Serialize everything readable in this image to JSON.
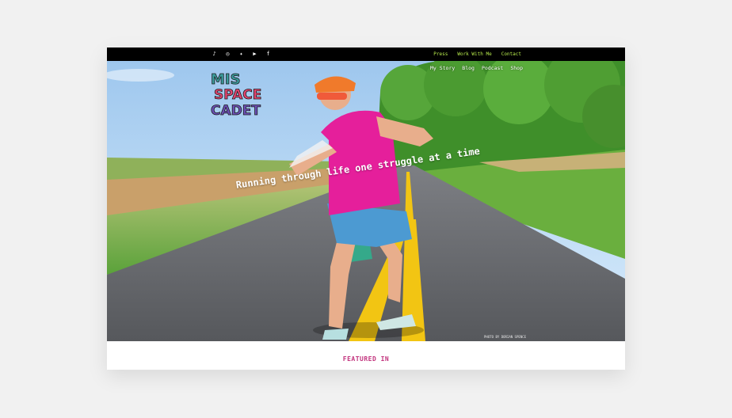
{
  "social": {
    "icons": [
      {
        "name": "tiktok-icon",
        "glyph": "♪"
      },
      {
        "name": "instagram-icon",
        "glyph": "◎"
      },
      {
        "name": "twitter-icon",
        "glyph": "✦"
      },
      {
        "name": "youtube-icon",
        "glyph": "▶"
      },
      {
        "name": "facebook-icon",
        "glyph": "f"
      }
    ]
  },
  "topnav": {
    "press": "Press",
    "work_with_me": "Work With Me",
    "contact": "Contact"
  },
  "mainnav": {
    "my_story": "My Story",
    "blog": "Blog",
    "podcast": "Podcast",
    "shop": "Shop"
  },
  "logo": {
    "line1": "MIS",
    "line2": "SPACE",
    "line3": "CADET"
  },
  "hero": {
    "tagline": "Running through life one struggle at a time",
    "photo_credit": "PHOTO BY DORIAN SPENCE"
  },
  "featured": {
    "label": "FEATURED IN"
  },
  "colors": {
    "accent_green": "#b6e94c",
    "featured_pink": "#c2337d",
    "topbar": "#000000"
  }
}
